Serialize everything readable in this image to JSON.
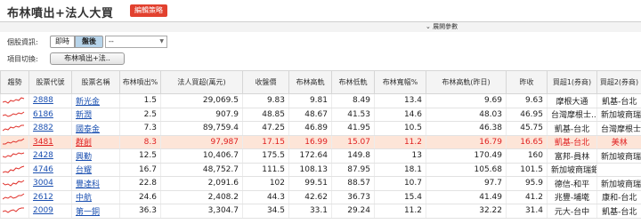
{
  "header": {
    "title": "布林噴出+法人大買",
    "edit_label": "編輯策略"
  },
  "params_toggle": {
    "icon": "chevron-down-icon",
    "label": "展開參數"
  },
  "stock_info": {
    "label": "個股資訊:",
    "segments": [
      "即時",
      "盤後"
    ],
    "selected_segment": "盤後",
    "select_value": "--"
  },
  "item_switch": {
    "label": "項目切換:",
    "button": "布林噴出+法.."
  },
  "table": {
    "headers": [
      "趨勢",
      "股票代號",
      "股票名稱",
      "布林噴出%",
      "法人買超(萬元)",
      "收盤價",
      "布林高軌",
      "布林低軌",
      "布林寬幅%",
      "布林高軌(昨日)",
      "昨收",
      "買超1(券商)",
      "買超2(券商)"
    ],
    "rows": [
      {
        "trend": "up",
        "code": "2888",
        "name": "新光金",
        "burst": "1.5",
        "buy": "29,069.5",
        "close": "9.83",
        "upper": "9.81",
        "lower": "8.49",
        "width": "13.4",
        "upper_prev": "9.69",
        "prev_close": "9.63",
        "broker1": "摩根大通",
        "broker2": "凱基-台北"
      },
      {
        "trend": "up",
        "code": "6186",
        "name": "新潤",
        "burst": "2.5",
        "buy": "907.9",
        "close": "48.85",
        "upper": "48.67",
        "lower": "41.53",
        "width": "14.6",
        "upper_prev": "48.03",
        "prev_close": "46.95",
        "broker1": "台灣摩根士...",
        "broker2": "新加坡商瑞銀"
      },
      {
        "trend": "up",
        "code": "2882",
        "name": "國泰金",
        "burst": "7.3",
        "buy": "89,759.4",
        "close": "47.25",
        "upper": "46.89",
        "lower": "41.95",
        "width": "10.5",
        "upper_prev": "46.38",
        "prev_close": "45.75",
        "broker1": "凱基-台北",
        "broker2": "台灣摩根士..."
      },
      {
        "trend": "up",
        "code": "3481",
        "name": "群創",
        "burst": "8.3",
        "buy": "97,987",
        "close": "17.15",
        "upper": "16.99",
        "lower": "15.07",
        "width": "11.2",
        "upper_prev": "16.79",
        "prev_close": "16.65",
        "broker1": "凱基-台北",
        "broker2": "美林",
        "highlight": true
      },
      {
        "trend": "up",
        "code": "2428",
        "name": "興勤",
        "burst": "12.5",
        "buy": "10,406.7",
        "close": "175.5",
        "upper": "172.64",
        "lower": "149.8",
        "width": "13",
        "upper_prev": "170.49",
        "prev_close": "160",
        "broker1": "富邦-員林",
        "broker2": "新加坡商瑞銀"
      },
      {
        "trend": "up",
        "code": "4746",
        "name": "台耀",
        "burst": "16.7",
        "buy": "48,752.7",
        "close": "111.5",
        "upper": "108.13",
        "lower": "87.95",
        "width": "18.1",
        "upper_prev": "105.68",
        "prev_close": "101.5",
        "broker1": "新加坡商瑞銀",
        "broker2": ""
      },
      {
        "trend": "up",
        "code": "3004",
        "name": "豐達科",
        "burst": "22.8",
        "buy": "2,091.6",
        "close": "102",
        "upper": "99.51",
        "lower": "88.57",
        "width": "10.7",
        "upper_prev": "97.7",
        "prev_close": "95.9",
        "broker1": "德信-和平",
        "broker2": "新加坡商瑞銀"
      },
      {
        "trend": "up",
        "code": "2612",
        "name": "中航",
        "burst": "24.6",
        "buy": "2,408.2",
        "close": "44.3",
        "upper": "42.62",
        "lower": "36.73",
        "width": "15.4",
        "upper_prev": "41.49",
        "prev_close": "41.2",
        "broker1": "兆豐-埔墘",
        "broker2": "康和-台北"
      },
      {
        "trend": "up",
        "code": "2009",
        "name": "第一銅",
        "burst": "36.3",
        "buy": "3,304.7",
        "close": "34.5",
        "upper": "33.1",
        "lower": "29.24",
        "width": "11.2",
        "upper_prev": "32.22",
        "prev_close": "31.4",
        "broker1": "元大-台中",
        "broker2": "凱基-台北"
      }
    ]
  },
  "colors": {
    "accent": "#e2412f",
    "link": "#1a4fb0",
    "highlight_bg": "#fde5d8",
    "highlight_text": "#e02020",
    "trend_red": "#e0302a",
    "trend_green": "#2a9a3a",
    "selected_segment": "#b7d4ea"
  }
}
